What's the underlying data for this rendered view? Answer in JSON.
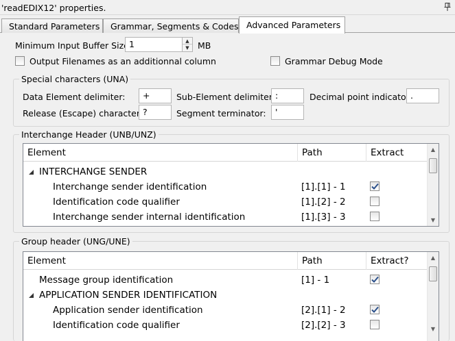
{
  "window": {
    "title": "'readEDIX12' properties."
  },
  "tabs": [
    {
      "label": "Standard Parameters"
    },
    {
      "label": "Grammar, Segments & Codes"
    },
    {
      "label": "Advanced Parameters"
    }
  ],
  "min_buffer": {
    "label": "Minimum Input Buffer Size:",
    "value": "1",
    "unit": "MB"
  },
  "options": {
    "output_filenames": {
      "label": "Output Filenames as an additionnal column",
      "checked": false
    },
    "grammar_debug": {
      "label": "Grammar Debug Mode",
      "checked": false
    }
  },
  "special_chars": {
    "title": "Special characters (UNA)",
    "data_element_delimiter": {
      "label": "Data Element delimiter:",
      "value": "+"
    },
    "sub_element_delimiter": {
      "label": "Sub-Element delimiter:",
      "value": ":"
    },
    "decimal_point": {
      "label": "Decimal point indicator:",
      "value": "."
    },
    "release_character": {
      "label": "Release (Escape) character:",
      "value": "?"
    },
    "segment_terminator": {
      "label": "Segment terminator:",
      "value": "'"
    }
  },
  "interchange": {
    "title": "Interchange Header (UNB/UNZ)",
    "columns": [
      "Element",
      "Path",
      "Extract"
    ],
    "rows": [
      {
        "element": "INTERCHANGE SENDER",
        "path": "",
        "group": true
      },
      {
        "element": "Interchange sender identification",
        "path": "[1].[1] - 1",
        "checked": true
      },
      {
        "element": "Identification code qualifier",
        "path": "[1].[2] - 2",
        "checked": false
      },
      {
        "element": "Interchange sender internal identification",
        "path": "[1].[3] - 3",
        "checked": false
      }
    ]
  },
  "group_header": {
    "title": "Group header (UNG/UNE)",
    "columns": [
      "Element",
      "Path",
      "Extract?"
    ],
    "rows": [
      {
        "element": "Message group identification",
        "path": "[1] - 1",
        "checked": true,
        "level": 1
      },
      {
        "element": "APPLICATION SENDER IDENTIFICATION",
        "path": "",
        "group": true
      },
      {
        "element": "Application sender identification",
        "path": "[2].[1] - 2",
        "checked": true,
        "level": 2
      },
      {
        "element": "Identification code qualifier",
        "path": "[2].[2] - 3",
        "checked": false,
        "level": 2
      }
    ]
  }
}
